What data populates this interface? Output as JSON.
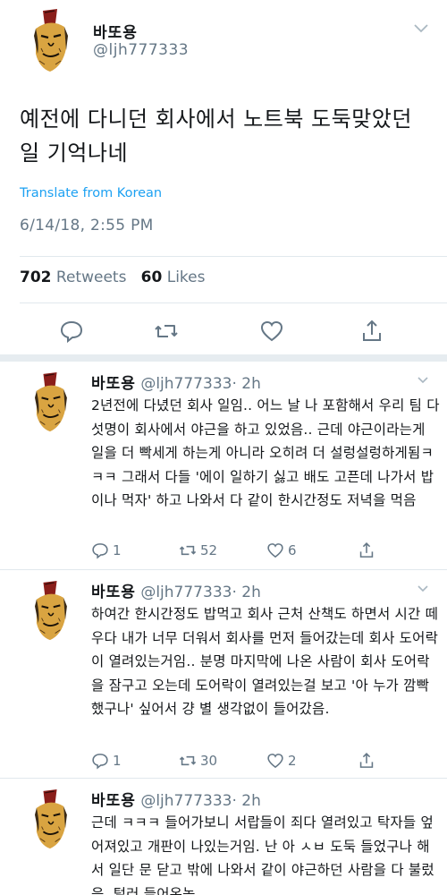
{
  "main_tweet": {
    "display_name": "바또용",
    "handle": "@ljh777333",
    "text": "예전에 다니던 회사에서 노트북 도둑맞았던 일 기억나네",
    "translate_label": "Translate from Korean",
    "timestamp": "6/14/18, 2:55 PM",
    "retweets_count": "702",
    "retweets_label": "Retweets",
    "likes_count": "60",
    "likes_label": "Likes",
    "icons": [
      "reply-icon",
      "retweet-icon",
      "like-icon",
      "share-icon"
    ]
  },
  "replies": [
    {
      "display_name": "바또용",
      "handle": "@ljh777333",
      "time": "· 2h",
      "text": "2년전에 다녔던 회사 일임.. 어느 날 나 포함해서 우리 팀 다섯명이 회사에서 야근을 하고 있었음.. 근데 야근이라는게 일을 더 빡세게 하는게 아니라 오히려 더 설렁설렁하게됨ㅋㅋㅋ 그래서 다들 '에이 일하기 싫고 배도 고픈데 나가서 밥이나 먹자' 하고 나와서 다 같이 한시간정도 저녁을 먹음",
      "reply_count": "1",
      "retweet_count": "52",
      "like_count": "6"
    },
    {
      "display_name": "바또용",
      "handle": "@ljh777333",
      "time": "· 2h",
      "text": "하여간 한시간정도 밥먹고 회사 근처 산책도 하면서 시간 떼우다 내가 너무 더워서 회사를 먼저 들어갔는데 회사 도어락이 열려있는거임.. 분명 마지막에 나온 사람이 회사 도어락을 잠구고 오는데 도어락이 열려있는걸 보고 '아 누가 깜빡했구나' 싶어서 걍 별 생각없이 들어갔음.",
      "reply_count": "1",
      "retweet_count": "30",
      "like_count": "2"
    },
    {
      "display_name": "바또용",
      "handle": "@ljh777333",
      "time": "· 2h",
      "text": "근데 ㅋㅋㅋ 들어가보니 서랍들이 죄다 열려있고 탁자들 엎어져있고 개판이 나있는거임. 난 아 ㅅㅂ 도둑 들었구나 해서 일단 문 닫고 밖에 나와서 같이 야근하던 사람을 다 불렀음. 털러 들어온놈"
    }
  ],
  "colors": {
    "link": "#1da1f2",
    "secondary_text": "#657786",
    "divider": "#e1e8ed"
  }
}
